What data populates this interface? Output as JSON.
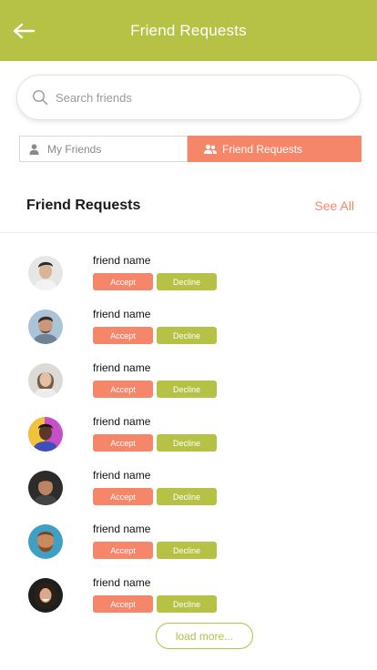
{
  "header": {
    "title": "Friend Requests",
    "back_icon": "arrow-left-icon"
  },
  "search": {
    "placeholder": "Search friends",
    "value": ""
  },
  "tabs": [
    {
      "label": "My Friends",
      "icon": "user-icon",
      "active": false
    },
    {
      "label": "Friend Requests",
      "icon": "users-icon",
      "active": true
    }
  ],
  "section": {
    "title": "Friend Requests",
    "see_all": "See All"
  },
  "requests": [
    {
      "name": "friend name",
      "accept": "Accept",
      "decline": "Decline"
    },
    {
      "name": "friend name",
      "accept": "Accept",
      "decline": "Decline"
    },
    {
      "name": "friend name",
      "accept": "Accept",
      "decline": "Decline"
    },
    {
      "name": "friend name",
      "accept": "Accept",
      "decline": "Decline"
    },
    {
      "name": "friend name",
      "accept": "Accept",
      "decline": "Decline"
    },
    {
      "name": "friend name",
      "accept": "Accept",
      "decline": "Decline"
    },
    {
      "name": "friend name",
      "accept": "Accept",
      "decline": "Decline"
    }
  ],
  "load_more": "load more...",
  "colors": {
    "primary": "#b5c246",
    "accent": "#f6866a"
  }
}
